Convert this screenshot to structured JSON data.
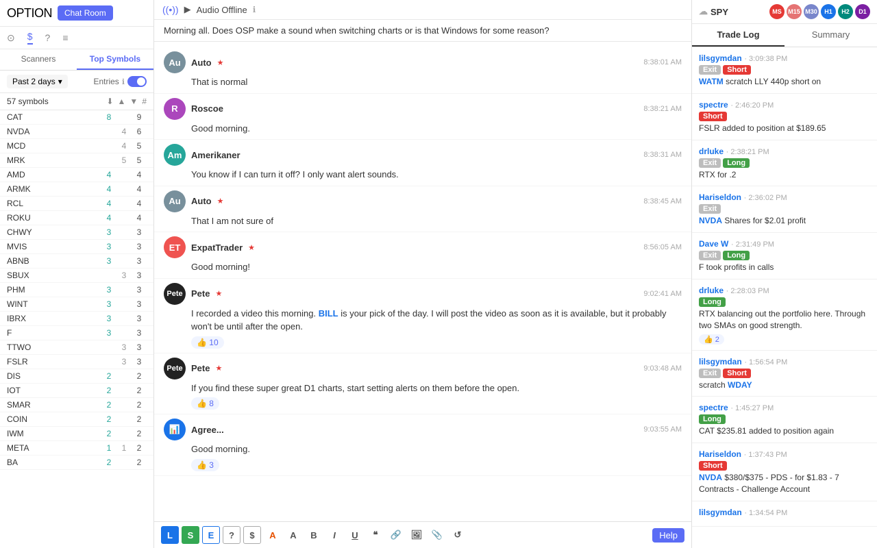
{
  "sidebar": {
    "logo": "OPTION",
    "chatRoomBtn": "Chat Room",
    "icons": [
      {
        "name": "scanners-icon",
        "label": "⊙",
        "active": false
      },
      {
        "name": "dollar-icon",
        "label": "$",
        "active": true
      },
      {
        "name": "question-icon",
        "label": "?",
        "active": false
      },
      {
        "name": "menu-icon",
        "label": "≡",
        "active": false
      }
    ],
    "tabs": [
      "Scanners",
      "Top Symbols"
    ],
    "activeTab": "Top Symbols",
    "filter": "Past 2 days",
    "entriesLabel": "Entries",
    "symbolsCount": "57 symbols",
    "colHeaders": {
      "sym": "",
      "up": "▲",
      "flat": "▼",
      "num": "#"
    },
    "symbols": [
      {
        "name": "CAT",
        "up": 8,
        "flat": 0,
        "num": 9
      },
      {
        "name": "NVDA",
        "up": 0,
        "flat": 4,
        "num": 6
      },
      {
        "name": "MCD",
        "up": 0,
        "flat": 4,
        "num": 5
      },
      {
        "name": "MRK",
        "up": 0,
        "flat": 5,
        "num": 5
      },
      {
        "name": "AMD",
        "up": 4,
        "flat": 0,
        "num": 4
      },
      {
        "name": "ARMK",
        "up": 4,
        "flat": 0,
        "num": 4
      },
      {
        "name": "RCL",
        "up": 4,
        "flat": 0,
        "num": 4
      },
      {
        "name": "ROKU",
        "up": 4,
        "flat": 0,
        "num": 4
      },
      {
        "name": "CHWY",
        "up": 3,
        "flat": 0,
        "num": 3
      },
      {
        "name": "MVIS",
        "up": 3,
        "flat": 0,
        "num": 3
      },
      {
        "name": "ABNB",
        "up": 3,
        "flat": 0,
        "num": 3
      },
      {
        "name": "SBUX",
        "up": 0,
        "flat": 3,
        "num": 3
      },
      {
        "name": "PHM",
        "up": 3,
        "flat": 0,
        "num": 3
      },
      {
        "name": "WINT",
        "up": 3,
        "flat": 0,
        "num": 3
      },
      {
        "name": "IBRX",
        "up": 3,
        "flat": 0,
        "num": 3
      },
      {
        "name": "F",
        "up": 3,
        "flat": 0,
        "num": 3
      },
      {
        "name": "TTWO",
        "up": 0,
        "flat": 3,
        "num": 3
      },
      {
        "name": "FSLR",
        "up": 0,
        "flat": 3,
        "num": 3
      },
      {
        "name": "DIS",
        "up": 2,
        "flat": 0,
        "num": 2
      },
      {
        "name": "IOT",
        "up": 2,
        "flat": 0,
        "num": 2
      },
      {
        "name": "SMAR",
        "up": 2,
        "flat": 0,
        "num": 2
      },
      {
        "name": "COIN",
        "up": 2,
        "flat": 0,
        "num": 2
      },
      {
        "name": "IWM",
        "up": 2,
        "flat": 0,
        "num": 2
      },
      {
        "name": "META",
        "up": 1,
        "flat": 1,
        "num": 2
      },
      {
        "name": "BA",
        "up": 2,
        "flat": 0,
        "num": 2
      }
    ]
  },
  "header": {
    "audioLabel": "Audio Offline"
  },
  "announce": {
    "text": "Morning all.  Does OSP make a sound when switching charts or is that Windows for some reason?"
  },
  "messages": [
    {
      "id": "m1",
      "user": "Auto",
      "avatar": "Au",
      "avatarBg": "#78909c",
      "star": true,
      "time": "8:38:01 AM",
      "text": "That is normal",
      "reactions": []
    },
    {
      "id": "m2",
      "user": "Roscoe",
      "avatar": "R",
      "avatarBg": "#ab47bc",
      "star": false,
      "time": "8:38:21 AM",
      "text": "Good morning.",
      "reactions": []
    },
    {
      "id": "m3",
      "user": "Amerikaner",
      "avatar": "Am",
      "avatarBg": "#26a69a",
      "star": false,
      "time": "8:38:31 AM",
      "text": "You know if I can turn it off?  I only want alert sounds.",
      "reactions": []
    },
    {
      "id": "m4",
      "user": "Auto",
      "avatar": "Au",
      "avatarBg": "#78909c",
      "star": true,
      "time": "8:38:45 AM",
      "text": "That I am not sure of",
      "reactions": []
    },
    {
      "id": "m5",
      "user": "ExpatTrader",
      "avatar": "ET",
      "avatarBg": "#ef5350",
      "star": true,
      "time": "8:56:05 AM",
      "text": "Good morning!",
      "reactions": []
    },
    {
      "id": "m6",
      "user": "Pete",
      "avatar": "Pete",
      "avatarBg": "#222",
      "star": true,
      "time": "9:02:41 AM",
      "textParts": [
        {
          "type": "text",
          "content": "I recorded a video this morning. "
        },
        {
          "type": "link",
          "content": "BILL"
        },
        {
          "type": "text",
          "content": " is your pick of the day. I will post the video as soon as it is available, but it probably won't be until after the open."
        }
      ],
      "reactions": [
        {
          "icon": "👍",
          "count": 10
        }
      ]
    },
    {
      "id": "m7",
      "user": "Pete",
      "avatar": "Pete",
      "avatarBg": "#222",
      "star": true,
      "time": "9:03:48 AM",
      "text": "If you find these super great D1 charts, start setting alerts on them before the open.",
      "reactions": [
        {
          "icon": "👍",
          "count": 8
        }
      ]
    },
    {
      "id": "m8",
      "user": "Agree...",
      "avatar": "📊",
      "avatarBg": "#1a73e8",
      "star": false,
      "time": "9:03:55 AM",
      "text": "Good morning.",
      "reactions": [
        {
          "icon": "👍",
          "count": 3
        }
      ]
    }
  ],
  "toolbar": {
    "buttons": [
      {
        "id": "btn-l",
        "label": "L",
        "style": "blue"
      },
      {
        "id": "btn-s",
        "label": "S",
        "style": "green"
      },
      {
        "id": "btn-e",
        "label": "E",
        "style": "outline-blue"
      },
      {
        "id": "btn-q",
        "label": "?",
        "style": "outline-gray"
      },
      {
        "id": "btn-dollar",
        "label": "$",
        "style": "outline-gray"
      },
      {
        "id": "btn-a1",
        "label": "A",
        "style": "orange"
      },
      {
        "id": "btn-a2",
        "label": "A",
        "style": "normal"
      },
      {
        "id": "btn-b",
        "label": "B",
        "style": "bold"
      },
      {
        "id": "btn-i",
        "label": "I",
        "style": "italic"
      },
      {
        "id": "btn-u",
        "label": "U",
        "style": "underline"
      },
      {
        "id": "btn-quote",
        "label": "\"",
        "style": "normal"
      },
      {
        "id": "btn-link",
        "label": "🔗",
        "style": "normal"
      },
      {
        "id": "btn-img",
        "label": "🖼",
        "style": "normal"
      },
      {
        "id": "btn-attach",
        "label": "📎",
        "style": "normal"
      },
      {
        "id": "btn-undo",
        "label": "↺",
        "style": "normal"
      }
    ],
    "helpLabel": "Help"
  },
  "rightPanel": {
    "spyLabel": "SPY",
    "userBadges": [
      "MS",
      "M15",
      "M30",
      "H1",
      "H2",
      "D1"
    ],
    "tabs": [
      "Trade Log",
      "Summary"
    ],
    "activeTab": "Trade Log",
    "trades": [
      {
        "user": "lilsgymdan",
        "time": "3:09:38 PM",
        "tags": [
          {
            "type": "exit",
            "label": "Exit"
          },
          {
            "type": "short",
            "label": "Short"
          }
        ],
        "text": "scratch LLY 440p short on ",
        "ticker": "WATM"
      },
      {
        "user": "spectre",
        "time": "2:46:20 PM",
        "tags": [
          {
            "type": "short",
            "label": "Short"
          }
        ],
        "text": "FSLR added to position at $189.65",
        "ticker": ""
      },
      {
        "user": "drluke",
        "time": "2:38:21 PM",
        "tags": [
          {
            "type": "exit",
            "label": "Exit"
          },
          {
            "type": "long",
            "label": "Long"
          }
        ],
        "text": "RTX for .2",
        "ticker": ""
      },
      {
        "user": "Hariseldon",
        "time": "2:36:02 PM",
        "tags": [
          {
            "type": "exit",
            "label": "Exit"
          }
        ],
        "text": "NVDA Shares for $2.01 profit",
        "ticker": "NVDA"
      },
      {
        "user": "Dave W",
        "time": "2:31:49 PM",
        "tags": [
          {
            "type": "exit",
            "label": "Exit"
          },
          {
            "type": "long",
            "label": "Long"
          }
        ],
        "text": "F took profits in calls",
        "ticker": ""
      },
      {
        "user": "drluke",
        "time": "2:28:03 PM",
        "tags": [
          {
            "type": "long",
            "label": "Long"
          }
        ],
        "text": "RTX balancing out the portfolio here.  Through two SMAs on good strength.",
        "ticker": "",
        "reactions": [
          {
            "icon": "👍",
            "count": 2
          }
        ]
      },
      {
        "user": "lilsgymdan",
        "time": "1:56:54 PM",
        "tags": [
          {
            "type": "exit",
            "label": "Exit"
          },
          {
            "type": "short",
            "label": "Short"
          }
        ],
        "text": "scratch WDAY",
        "ticker": "WDAY"
      },
      {
        "user": "spectre",
        "time": "1:45:27 PM",
        "tags": [
          {
            "type": "long",
            "label": "Long"
          }
        ],
        "text": "CAT $235.81 added to position again",
        "ticker": ""
      },
      {
        "user": "Hariseldon",
        "time": "1:37:43 PM",
        "tags": [
          {
            "type": "short",
            "label": "Short"
          }
        ],
        "text": "NVDA $380/$375 - PDS - for $1.83 - 7 Contracts - Challenge Account",
        "ticker": "NVDA"
      },
      {
        "user": "lilsgymdan",
        "time": "1:34:54 PM",
        "tags": [],
        "text": "",
        "ticker": ""
      }
    ]
  }
}
